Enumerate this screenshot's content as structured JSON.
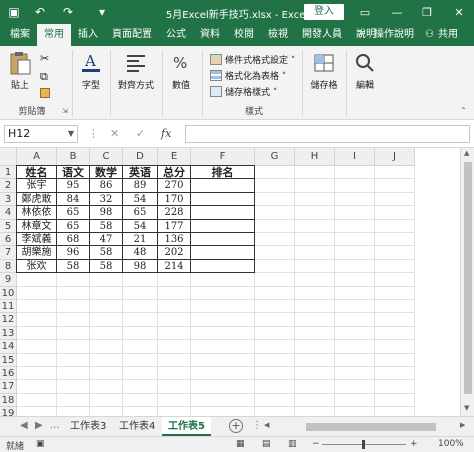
{
  "titlebar": {
    "title": "5月Excel新手技巧.xlsx - Excel",
    "login": "登入",
    "undo": "↶",
    "redo": "↷",
    "save": "▣",
    "quick": "▾",
    "ribbon_opts": "▭",
    "minimize": "—",
    "restore": "❐",
    "close": "✕"
  },
  "tabs": [
    "檔案",
    "常用",
    "插入",
    "頁面配置",
    "公式",
    "資料",
    "校閱",
    "檢視",
    "開發人員",
    "說明"
  ],
  "tell_me": "操作說明",
  "share": "共用",
  "ribbon": {
    "paste": "貼上",
    "clipboard": "剪貼簿",
    "font": "字型",
    "alignment": "對齊方式",
    "number": "數值",
    "cond_format": "條件式格式設定 ˅",
    "format_table": "格式化為表格 ˅",
    "cell_styles": "儲存格樣式 ˅",
    "styles": "樣式",
    "cells": "儲存格",
    "editing": "編輯"
  },
  "formula_bar": {
    "name_box": "H12",
    "cancel": "✕",
    "enter": "✓",
    "fx": "fx"
  },
  "columns": [
    "A",
    "B",
    "C",
    "D",
    "E",
    "F",
    "G",
    "H",
    "I",
    "J"
  ],
  "rows": [
    "1",
    "2",
    "3",
    "4",
    "5",
    "6",
    "7",
    "8",
    "9",
    "10",
    "11",
    "12",
    "13",
    "14",
    "15",
    "16",
    "17",
    "18",
    "19"
  ],
  "table": {
    "header": [
      "姓名",
      "语文",
      "数学",
      "英语",
      "总分",
      "排名"
    ],
    "data": [
      [
        "张宇",
        "95",
        "86",
        "89",
        "270",
        ""
      ],
      [
        "鄭虎敢",
        "84",
        "32",
        "54",
        "170",
        ""
      ],
      [
        "林依依",
        "65",
        "98",
        "65",
        "228",
        ""
      ],
      [
        "林章文",
        "65",
        "58",
        "54",
        "177",
        ""
      ],
      [
        "李斌義",
        "68",
        "47",
        "21",
        "136",
        ""
      ],
      [
        "胡樂施",
        "96",
        "58",
        "48",
        "202",
        ""
      ],
      [
        "张欢",
        "58",
        "58",
        "98",
        "214",
        ""
      ]
    ]
  },
  "sheets": {
    "nav_prev": "◀",
    "nav_next": "▶",
    "ellipsis": "...",
    "tabs": [
      "工作表3",
      "工作表4",
      "工作表5"
    ],
    "active": "工作表5",
    "add": "+"
  },
  "status": {
    "ready": "就緒",
    "zoom_minus": "−",
    "zoom_plus": "+",
    "zoom": "100%"
  }
}
